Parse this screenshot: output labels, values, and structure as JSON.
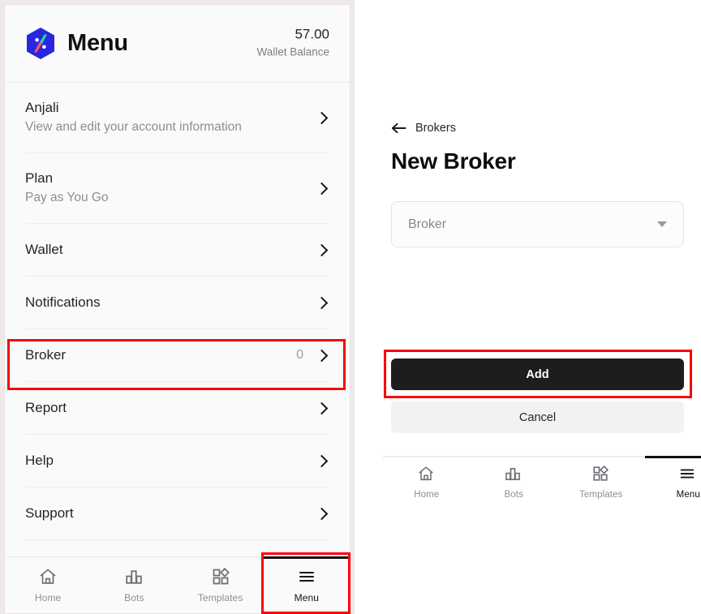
{
  "accent": {
    "highlight_box": "#fb0007",
    "logo_blue": "#2826df",
    "logo_green": "#1fd99b",
    "logo_red": "#f4516c",
    "button_dark": "#1d1d1d"
  },
  "left_screen": {
    "header": {
      "logo_icon": "app-logo-hex-icon",
      "title": "Menu",
      "wallet_amount": "57.00",
      "wallet_label": "Wallet Balance"
    },
    "menu_items": [
      {
        "title": "Anjali",
        "subtitle": "View and edit your account information",
        "count": "",
        "chevron_icon": "chevron-right-icon"
      },
      {
        "title": "Plan",
        "subtitle": "Pay as You Go",
        "count": "",
        "chevron_icon": "chevron-right-icon"
      },
      {
        "title": "Wallet",
        "subtitle": "",
        "count": "",
        "chevron_icon": "chevron-right-icon"
      },
      {
        "title": "Notifications",
        "subtitle": "",
        "count": "",
        "chevron_icon": "chevron-right-icon"
      },
      {
        "title": "Broker",
        "subtitle": "",
        "count": "0",
        "chevron_icon": "chevron-right-icon"
      },
      {
        "title": "Report",
        "subtitle": "",
        "count": "",
        "chevron_icon": "chevron-right-icon"
      },
      {
        "title": "Help",
        "subtitle": "",
        "count": "",
        "chevron_icon": "chevron-right-icon"
      },
      {
        "title": "Support",
        "subtitle": "",
        "count": "",
        "chevron_icon": "chevron-right-icon"
      }
    ],
    "bottom_nav": [
      {
        "label": "Home",
        "icon": "home-icon",
        "active": false
      },
      {
        "label": "Bots",
        "icon": "bar-chart-icon",
        "active": false
      },
      {
        "label": "Templates",
        "icon": "templates-grid-icon",
        "active": false
      },
      {
        "label": "Menu",
        "icon": "hamburger-menu-icon",
        "active": true
      }
    ]
  },
  "right_screen": {
    "back_label": "Brokers",
    "back_icon": "arrow-left-icon",
    "heading": "New Broker",
    "broker_select": {
      "value": "Broker",
      "placeholder": "Broker",
      "caret_icon": "caret-down-icon"
    },
    "add_label": "Add",
    "cancel_label": "Cancel",
    "bottom_nav": [
      {
        "label": "Home",
        "icon": "home-icon",
        "active": false
      },
      {
        "label": "Bots",
        "icon": "bar-chart-icon",
        "active": false
      },
      {
        "label": "Templates",
        "icon": "templates-grid-icon",
        "active": false
      },
      {
        "label": "Menu",
        "icon": "hamburger-menu-icon",
        "active": true
      }
    ]
  },
  "annotations": [
    {
      "target": "broker-menu-row",
      "color": "#fb0007"
    },
    {
      "target": "left-nav-menu-tab",
      "color": "#fb0007"
    },
    {
      "target": "add-button",
      "color": "#fb0007"
    }
  ]
}
